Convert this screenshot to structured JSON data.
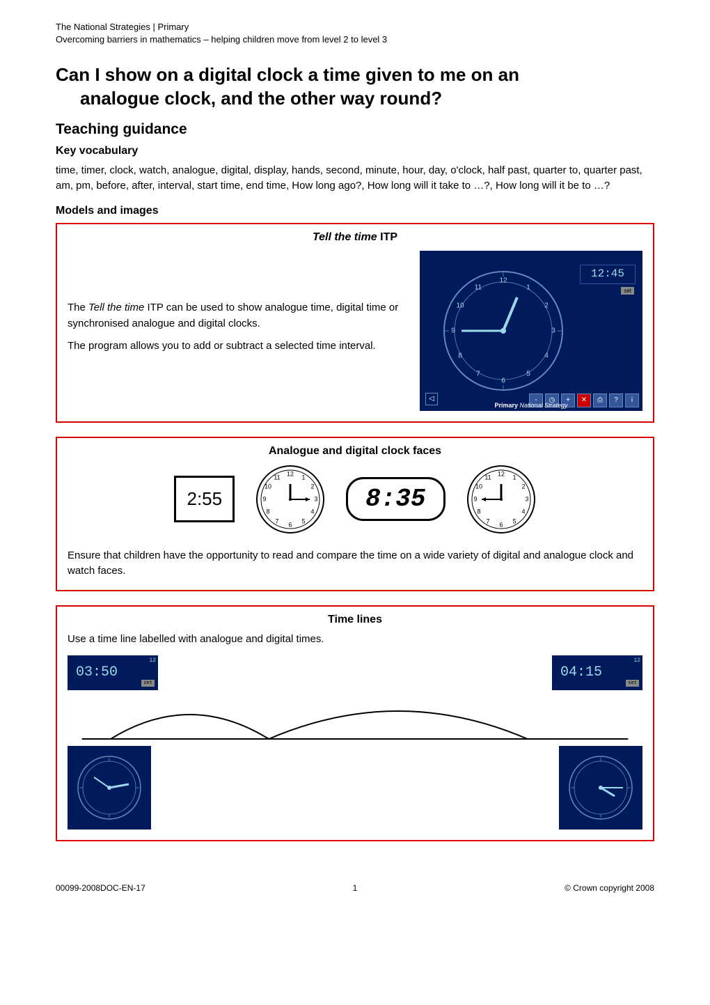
{
  "header": {
    "line1": "The National Strategies | Primary",
    "line2": "Overcoming barriers in mathematics – helping children move from level 2 to level 3"
  },
  "title_line1": "Can I show on a digital clock a time given to me on an",
  "title_line2": "analogue clock, and the other way round?",
  "subtitle": "Teaching guidance",
  "key_vocab_heading": "Key vocabulary",
  "key_vocab_text": "time, timer, clock, watch, analogue, digital, display, hands, second, minute, hour, day, o'clock, half past, quarter to, quarter past, am, pm, before, after, interval, start time, end time, How long ago?, How long will it take to …?, How long will it be to …?",
  "models_heading": "Models and images",
  "box1": {
    "title_italic": "Tell the time",
    "title_rest": " ITP",
    "para1_pre": "The ",
    "para1_italic": "Tell the time",
    "para1_post": " ITP can be used to show analogue time, digital time or synchronised analogue and digital clocks.",
    "para2": "The program allows you to add or subtract a selected time interval.",
    "digital_value": "12:45",
    "set_label": "set",
    "strategy_bold": "Primary",
    "strategy_italic": "National Strategy"
  },
  "box2": {
    "title": "Analogue and digital clock faces",
    "digital1": "2:55",
    "digital2": "8:35",
    "note": "Ensure that children have the opportunity to read and compare the time on a wide variety of digital and analogue clock and watch faces."
  },
  "box3": {
    "title": "Time lines",
    "intro": "Use a time line labelled with analogue and digital times.",
    "digital_left": "03:50",
    "digital_right": "04:15",
    "set_label": "set",
    "corner_label": "12"
  },
  "footer": {
    "left": "00099-2008DOC-EN-17",
    "center": "1",
    "right": "© Crown copyright 2008"
  },
  "clock_numbers": [
    "12",
    "1",
    "2",
    "3",
    "4",
    "5",
    "6",
    "7",
    "8",
    "9",
    "10",
    "11"
  ]
}
